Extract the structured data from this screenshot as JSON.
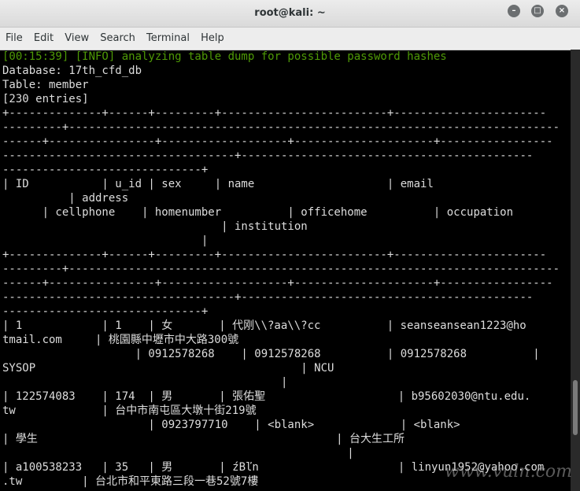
{
  "window": {
    "title": "root@kali: ~",
    "minimize_icon": "minimize-icon",
    "maximize_icon": "maximize-icon",
    "close_icon": "close-icon"
  },
  "menu": [
    "File",
    "Edit",
    "View",
    "Search",
    "Terminal",
    "Help"
  ],
  "terminal": {
    "lines": [
      "[00:15:39] [INFO] analyzing table dump for possible password hashes",
      "Database: 17th_cfd_db",
      "Table: member",
      "[230 entries]",
      "+--------------+------+---------+-------------------------+-----------------------",
      "---------+--------------------------------------------------------------------------",
      "------+----------------+-------------------+---------------------+-----------------",
      "-----------------------------------+--------------------------------------------",
      "------------------------------+",
      "| ID           | u_id | sex     | name                    | email",
      "          | address",
      "      | cellphone    | homenumber          | officehome          | occupation",
      "                                 | institution",
      "                              |",
      "+--------------+------+---------+-------------------------+-----------------------",
      "---------+--------------------------------------------------------------------------",
      "------+----------------+-------------------+---------------------+-----------------",
      "-----------------------------------+--------------------------------------------",
      "------------------------------+",
      "| 1            | 1    | 女       | 代刚\\\\?aa\\\\?cc          | seanseansean1223@ho",
      "tmail.com     | 桃園縣中壢市中大路300號",
      "                    | 0912578268    | 0912578268          | 0912578268          |",
      "SYSOP                                        | NCU",
      "                                          |",
      "| 122574083    | 174  | 男       | 張佑聖                    | b95602030@ntu.edu.",
      "tw             | 台中市南屯區大墩十街219號",
      "                      | 0923797710    | <blank>             | <blank>",
      "| 學生                                             | 台大生工所",
      "                                                    |",
      "| a100538233   | 35   | 男       | źBľn                     | linyun1952@yahoo.com",
      ".tw         | 台北市和平東路三段一巷52號7樓"
    ]
  },
  "watermark": "www.vuln.com"
}
